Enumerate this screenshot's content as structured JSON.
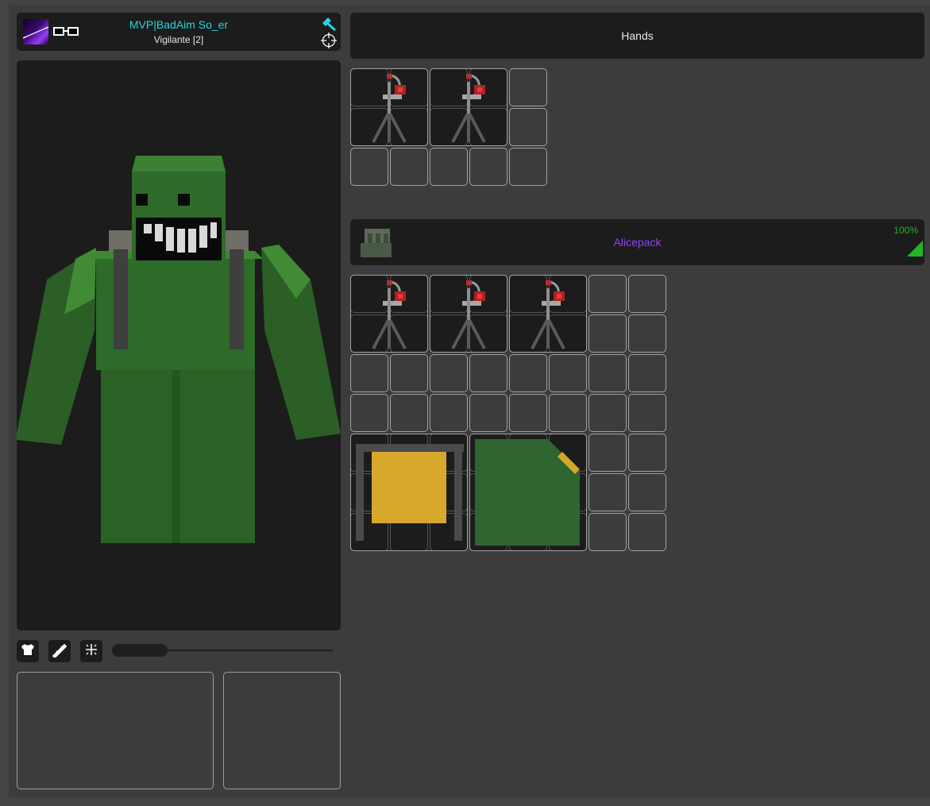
{
  "player": {
    "name": "MVP|BadAim So_er",
    "title": "Vigilante [2]",
    "avatar_icon": "player-avatar",
    "accessory_icon": "glasses-icon",
    "status_icons": [
      "admin-hammer-icon",
      "crosshair-icon"
    ],
    "name_color": "#22d6e0"
  },
  "character_viewport": {
    "model": "green-grinning-character"
  },
  "controls": {
    "buttons": [
      "clothing-icon",
      "weapon-icon",
      "sparkle-icon"
    ],
    "zoom": 0.25
  },
  "equipment_slots": [
    "primary-slot",
    "secondary-slot"
  ],
  "hands": {
    "title": "Hands",
    "columns": 5,
    "rows": 3,
    "items": [
      {
        "name": "tripod-turret",
        "col": 0,
        "row": 0,
        "w": 2,
        "h": 2
      },
      {
        "name": "tripod-turret",
        "col": 2,
        "row": 0,
        "w": 2,
        "h": 2
      }
    ]
  },
  "backpack": {
    "name": "Alicepack",
    "quality": "100%",
    "name_color": "#9040ff",
    "quality_color": "#22b522",
    "columns": 8,
    "rows": 7,
    "items": [
      {
        "name": "tripod-turret",
        "col": 0,
        "row": 0,
        "w": 2,
        "h": 2
      },
      {
        "name": "tripod-turret",
        "col": 2,
        "row": 0,
        "w": 2,
        "h": 2
      },
      {
        "name": "tripod-turret",
        "col": 4,
        "row": 0,
        "w": 2,
        "h": 2
      },
      {
        "name": "yellow-crate",
        "col": 0,
        "row": 4,
        "w": 3,
        "h": 3
      },
      {
        "name": "green-notebook",
        "col": 3,
        "row": 4,
        "w": 3,
        "h": 3
      }
    ]
  }
}
